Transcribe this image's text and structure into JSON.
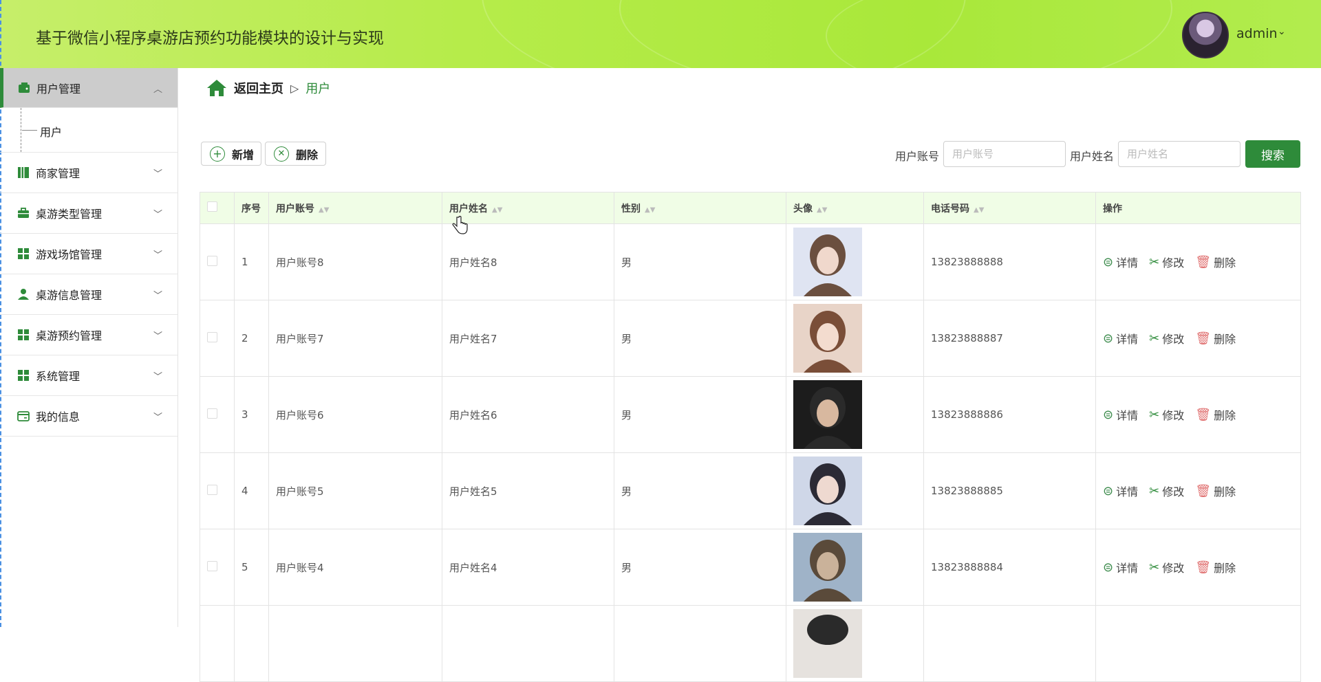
{
  "header": {
    "title": "基于微信小程序桌游店预约功能模块的设计与实现",
    "username": "admin"
  },
  "sidebar": {
    "items": [
      {
        "label": "用户管理",
        "icon": "wallet-icon",
        "active": true
      },
      {
        "label": "商家管理",
        "icon": "book-icon"
      },
      {
        "label": "桌游类型管理",
        "icon": "briefcase-icon"
      },
      {
        "label": "游戏场馆管理",
        "icon": "grid-icon"
      },
      {
        "label": "桌游信息管理",
        "icon": "person-icon"
      },
      {
        "label": "桌游预约管理",
        "icon": "grid-icon"
      },
      {
        "label": "系统管理",
        "icon": "grid-icon"
      },
      {
        "label": "我的信息",
        "icon": "card-icon"
      }
    ],
    "submenu_label": "用户"
  },
  "breadcrumb": {
    "home": "返回主页",
    "separator": "▷",
    "current": "用户"
  },
  "toolbar": {
    "add_label": "新增",
    "delete_label": "删除"
  },
  "search": {
    "account_label": "用户账号",
    "account_placeholder": "用户账号",
    "name_label": "用户姓名",
    "name_placeholder": "用户姓名",
    "button_label": "搜索"
  },
  "table": {
    "headers": [
      "序号",
      "用户账号",
      "用户姓名",
      "性别",
      "头像",
      "电话号码",
      "操作"
    ],
    "rows": [
      {
        "index": "1",
        "account": "用户账号8",
        "name": "用户姓名8",
        "gender": "男",
        "phone": "13823888888"
      },
      {
        "index": "2",
        "account": "用户账号7",
        "name": "用户姓名7",
        "gender": "男",
        "phone": "13823888887"
      },
      {
        "index": "3",
        "account": "用户账号6",
        "name": "用户姓名6",
        "gender": "男",
        "phone": "13823888886"
      },
      {
        "index": "4",
        "account": "用户账号5",
        "name": "用户姓名5",
        "gender": "男",
        "phone": "13823888885"
      },
      {
        "index": "5",
        "account": "用户账号4",
        "name": "用户姓名4",
        "gender": "男",
        "phone": "13823888884"
      }
    ],
    "actions": {
      "detail": "详情",
      "edit": "修改",
      "delete": "删除"
    }
  },
  "colors": {
    "accent": "#2e8b3a",
    "header_bg": "#b4ec48",
    "table_header_bg": "#f0fde6"
  }
}
